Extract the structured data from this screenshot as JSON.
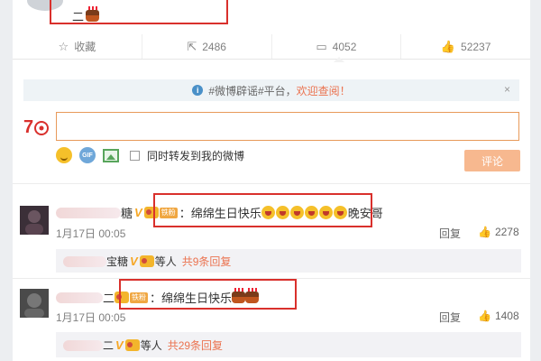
{
  "top_post": {
    "text": "二"
  },
  "actions": [
    {
      "icon": "star-icon",
      "label": "收藏"
    },
    {
      "icon": "repost-icon",
      "label": "2486"
    },
    {
      "icon": "comment-icon",
      "label": "4052"
    },
    {
      "icon": "like-icon",
      "label": "52237"
    }
  ],
  "notice": {
    "prefix": "#微博辟谣#平台，",
    "link": "欢迎查阅！",
    "close": "×"
  },
  "composer": {
    "placeholder": "",
    "repost_label": "同时转发到我的微博",
    "submit_label": "评论",
    "gif_label": "GIF"
  },
  "comments": [
    {
      "name_suffix": "糖",
      "tag": "铁粉",
      "text_prefix": "：绵绵生日快乐",
      "text_suffix": "晚安哥",
      "time": "1月17日 00:05",
      "reply_label": "回复",
      "likes": "2278",
      "sub": {
        "name_suffix": "宝糖",
        "text": "等人",
        "count": "共9条回复"
      }
    },
    {
      "name_suffix": "二",
      "tag": "铁粉",
      "text_prefix": "：绵绵生日快乐",
      "text_suffix": "",
      "time": "1月17日 00:05",
      "reply_label": "回复",
      "likes": "1408",
      "sub": {
        "name_suffix": "二",
        "text": "等人",
        "count": "共29条回复"
      }
    }
  ]
}
